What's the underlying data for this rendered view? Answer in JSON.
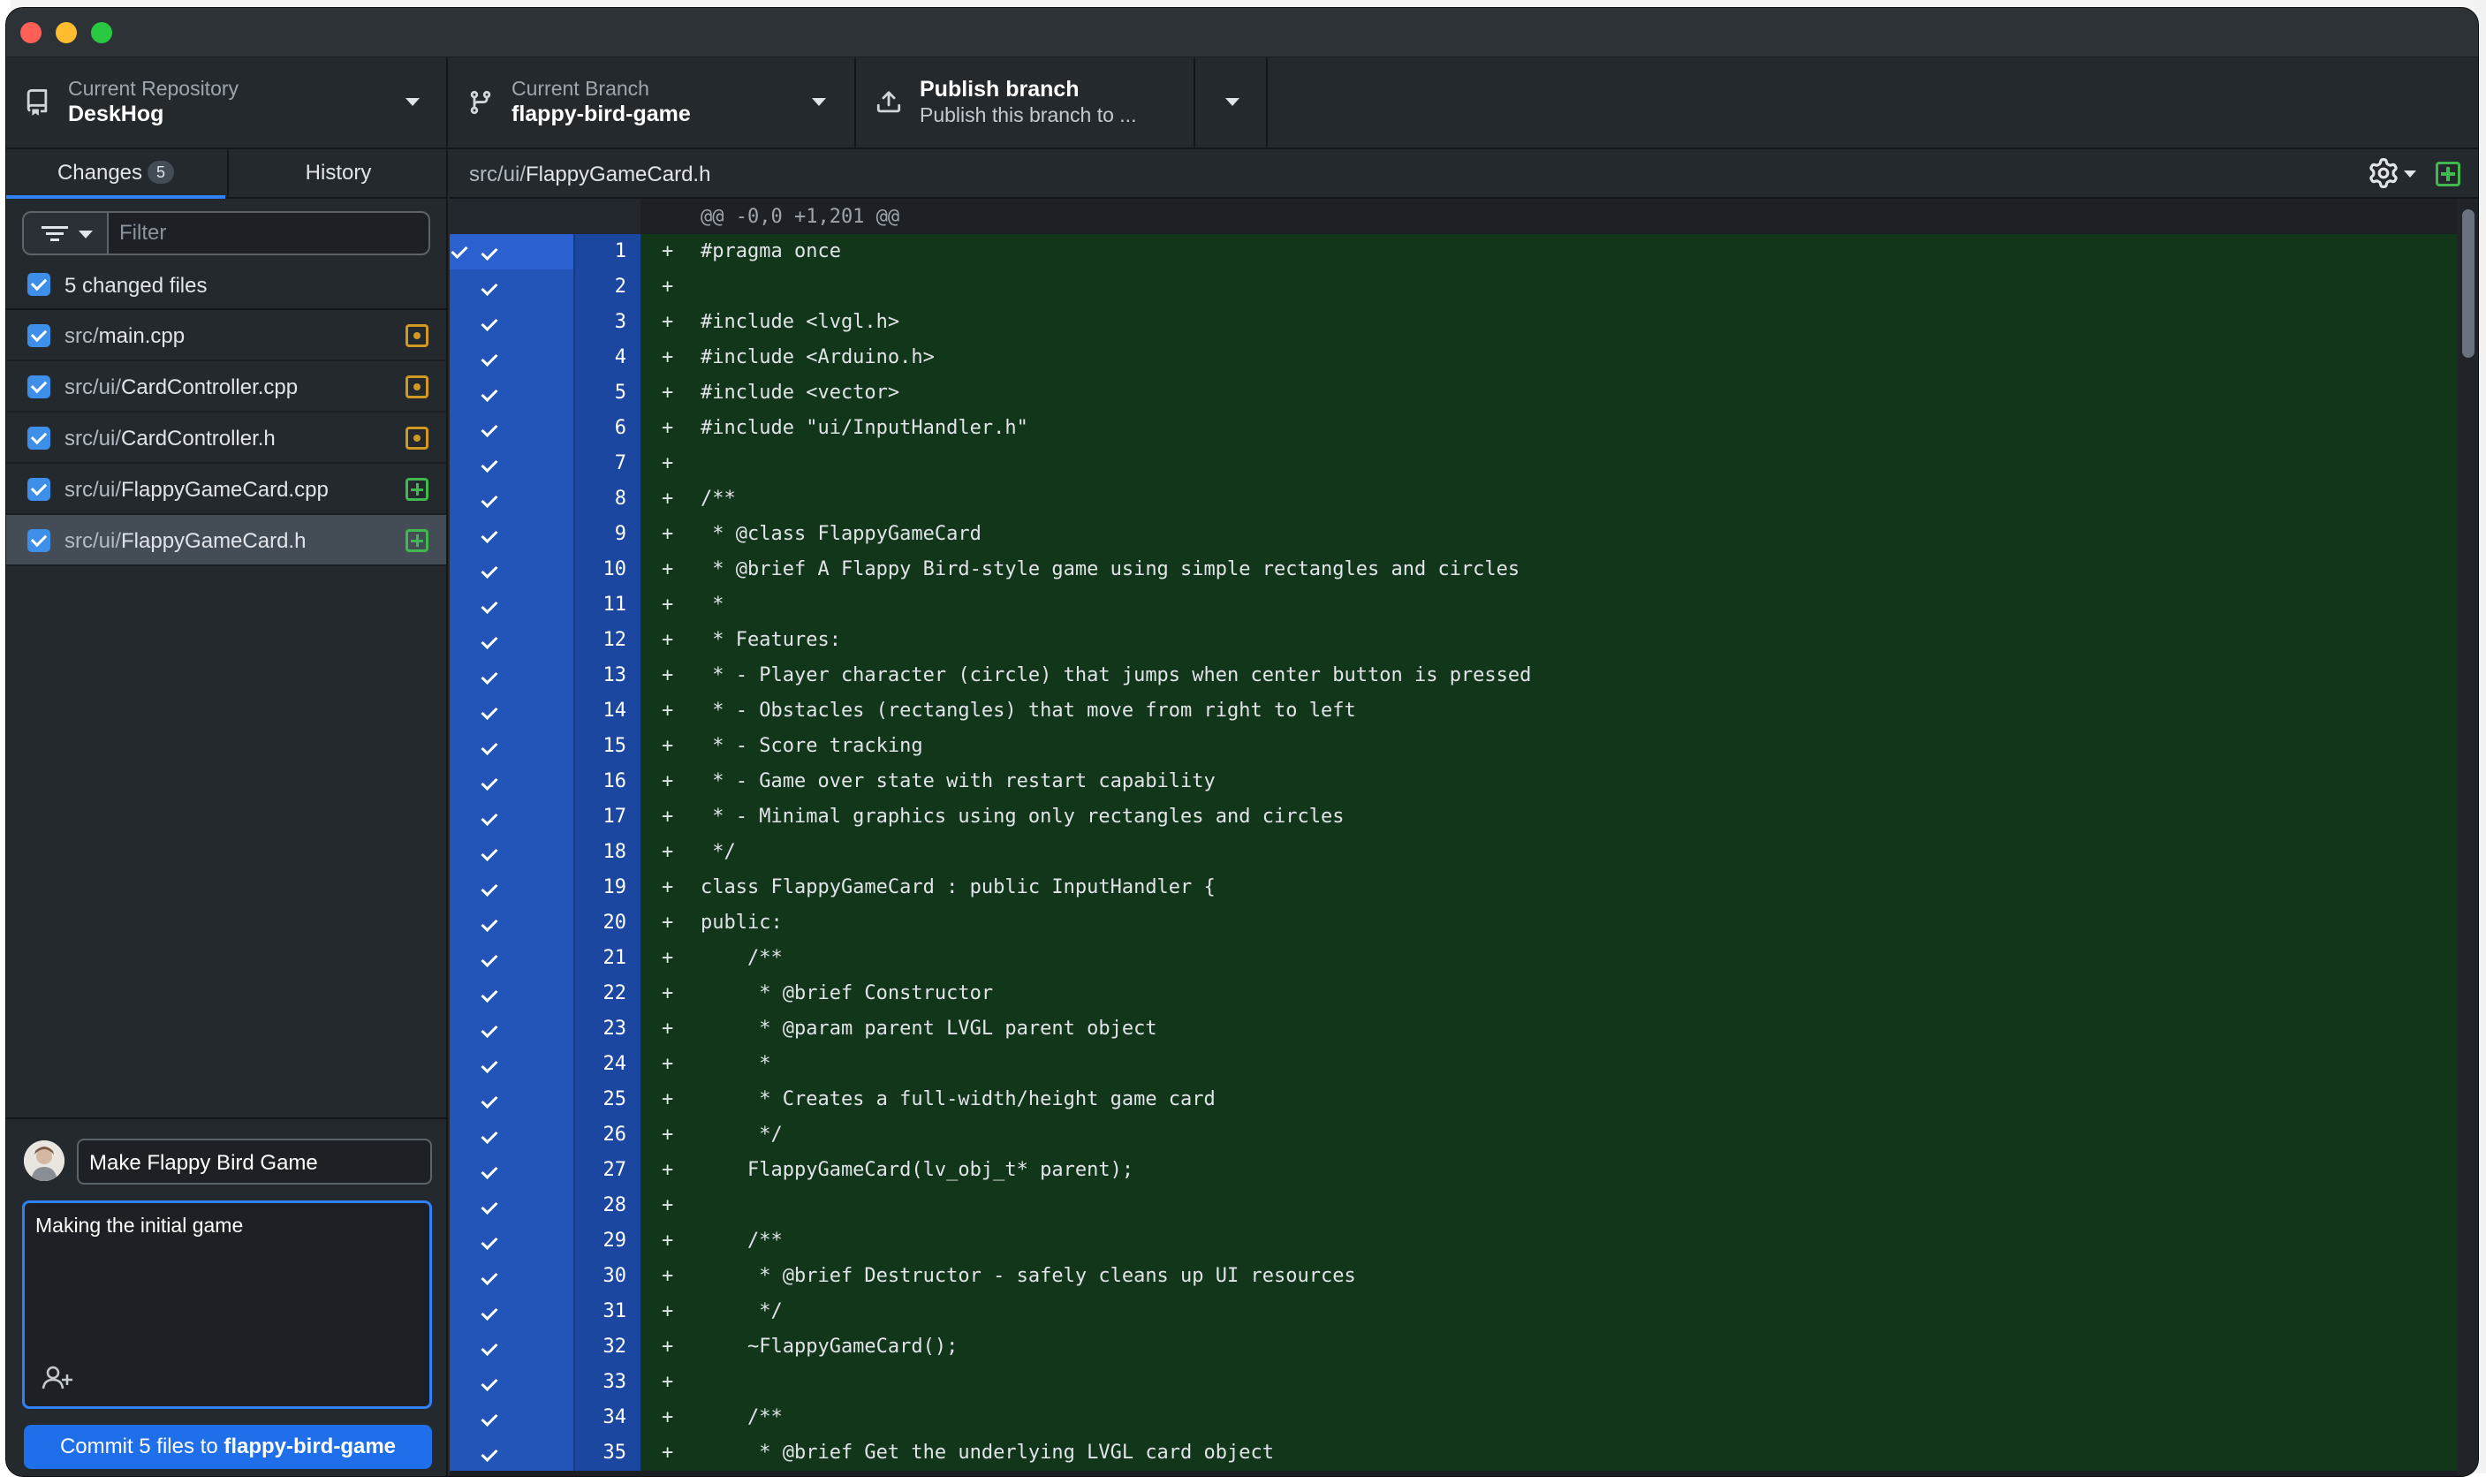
{
  "toolbar": {
    "repository": {
      "label": "Current Repository",
      "value": "DeskHog"
    },
    "branch": {
      "label": "Current Branch",
      "value": "flappy-bird-game"
    },
    "publish": {
      "title": "Publish branch",
      "subtitle": "Publish this branch to ..."
    }
  },
  "sidebar": {
    "tabs": [
      {
        "label": "Changes",
        "count": "5"
      },
      {
        "label": "History"
      }
    ],
    "filter_placeholder": "Filter",
    "changed_files_label": "5 changed files",
    "files": [
      {
        "dir": "src/",
        "name": "main.cpp",
        "status": "modified"
      },
      {
        "dir": "src/ui/",
        "name": "CardController.cpp",
        "status": "modified"
      },
      {
        "dir": "src/ui/",
        "name": "CardController.h",
        "status": "modified"
      },
      {
        "dir": "src/ui/",
        "name": "FlappyGameCard.cpp",
        "status": "added"
      },
      {
        "dir": "src/ui/",
        "name": "FlappyGameCard.h",
        "status": "added",
        "selected": true
      }
    ]
  },
  "commit": {
    "summary": "Make Flappy Bird Game",
    "description": "Making the initial game",
    "button_prefix": "Commit 5 files to ",
    "button_branch": "flappy-bird-game"
  },
  "diff": {
    "path_dir": "src/ui/",
    "path_file": "FlappyGameCard.h",
    "hunk_header": "@@ -0,0 +1,201 @@",
    "lines": [
      {
        "n": "1",
        "code": "#pragma once"
      },
      {
        "n": "2",
        "code": ""
      },
      {
        "n": "3",
        "code": "#include <lvgl.h>"
      },
      {
        "n": "4",
        "code": "#include <Arduino.h>"
      },
      {
        "n": "5",
        "code": "#include <vector>"
      },
      {
        "n": "6",
        "code": "#include \"ui/InputHandler.h\""
      },
      {
        "n": "7",
        "code": ""
      },
      {
        "n": "8",
        "code": "/**"
      },
      {
        "n": "9",
        "code": " * @class FlappyGameCard"
      },
      {
        "n": "10",
        "code": " * @brief A Flappy Bird-style game using simple rectangles and circles"
      },
      {
        "n": "11",
        "code": " *"
      },
      {
        "n": "12",
        "code": " * Features:"
      },
      {
        "n": "13",
        "code": " * - Player character (circle) that jumps when center button is pressed"
      },
      {
        "n": "14",
        "code": " * - Obstacles (rectangles) that move from right to left"
      },
      {
        "n": "15",
        "code": " * - Score tracking"
      },
      {
        "n": "16",
        "code": " * - Game over state with restart capability"
      },
      {
        "n": "17",
        "code": " * - Minimal graphics using only rectangles and circles"
      },
      {
        "n": "18",
        "code": " */"
      },
      {
        "n": "19",
        "code": "class FlappyGameCard : public InputHandler {"
      },
      {
        "n": "20",
        "code": "public:"
      },
      {
        "n": "21",
        "code": "    /**"
      },
      {
        "n": "22",
        "code": "     * @brief Constructor"
      },
      {
        "n": "23",
        "code": "     * @param parent LVGL parent object"
      },
      {
        "n": "24",
        "code": "     *"
      },
      {
        "n": "25",
        "code": "     * Creates a full-width/height game card"
      },
      {
        "n": "26",
        "code": "     */"
      },
      {
        "n": "27",
        "code": "    FlappyGameCard(lv_obj_t* parent);"
      },
      {
        "n": "28",
        "code": ""
      },
      {
        "n": "29",
        "code": "    /**"
      },
      {
        "n": "30",
        "code": "     * @brief Destructor - safely cleans up UI resources"
      },
      {
        "n": "31",
        "code": "     */"
      },
      {
        "n": "32",
        "code": "    ~FlappyGameCard();"
      },
      {
        "n": "33",
        "code": ""
      },
      {
        "n": "34",
        "code": "    /**"
      },
      {
        "n": "35",
        "code": "     * @brief Get the underlying LVGL card object"
      }
    ]
  }
}
